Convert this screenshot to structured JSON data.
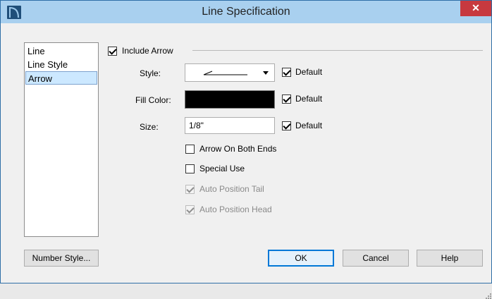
{
  "window": {
    "title": "Line Specification",
    "close_glyph": "✕",
    "app_icon": "app-icon"
  },
  "sidebar": {
    "items": [
      {
        "label": "Line",
        "selected": false
      },
      {
        "label": "Line Style",
        "selected": false
      },
      {
        "label": "Arrow",
        "selected": true
      }
    ]
  },
  "arrow": {
    "include_arrow": {
      "label": "Include Arrow",
      "checked": true
    },
    "style": {
      "label": "Style:",
      "default_label": "Default",
      "default_checked": true
    },
    "fill_color": {
      "label": "Fill Color:",
      "color": "#000000",
      "default_label": "Default",
      "default_checked": true
    },
    "size": {
      "label": "Size:",
      "value": "1/8\"",
      "default_label": "Default",
      "default_checked": true
    },
    "both_ends": {
      "label": "Arrow On Both Ends",
      "checked": false
    },
    "special_use": {
      "label": "Special Use",
      "checked": false
    },
    "auto_tail": {
      "label": "Auto Position Tail",
      "checked": true,
      "disabled": true
    },
    "auto_head": {
      "label": "Auto Position Head",
      "checked": true,
      "disabled": true
    }
  },
  "footer": {
    "number_style": "Number Style...",
    "ok": "OK",
    "cancel": "Cancel",
    "help": "Help"
  },
  "colors": {
    "titlebar": "#a9d0ef",
    "close": "#c7393f",
    "selection": "#cce8ff",
    "default_button_border": "#0078d7"
  }
}
